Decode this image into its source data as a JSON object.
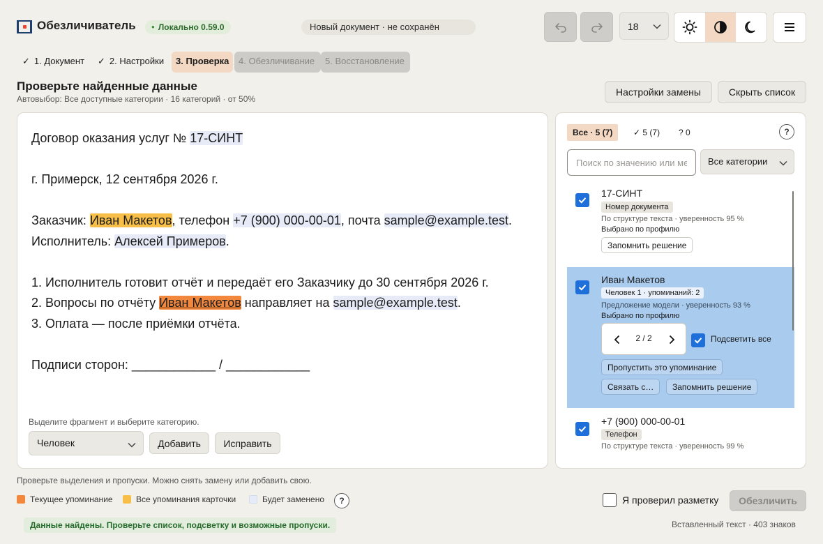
{
  "app": {
    "title": "Обезличиватель",
    "version_badge": "Локально 0.59.0",
    "document_name": "Новый документ · не сохранён",
    "font_size": "18",
    "accent_color": "#f3d8c3",
    "checkbox_color": "#1e6fd9"
  },
  "toolbar": {
    "undo_icon": "undo-icon",
    "redo_icon": "redo-icon",
    "themes": [
      "sun-icon",
      "contrast-icon",
      "moon-icon"
    ],
    "active_theme": "contrast-icon",
    "menu_icon": "hamburger-icon"
  },
  "steps": [
    {
      "label": "1. Документ",
      "state": "done"
    },
    {
      "label": "2. Настройки",
      "state": "done"
    },
    {
      "label": "3. Проверка",
      "state": "current"
    },
    {
      "label": "4. Обезличивание",
      "state": "locked"
    },
    {
      "label": "5. Восстановление",
      "state": "locked"
    }
  ],
  "page": {
    "title": "Проверьте найденные данные",
    "subtitle": "Автовыбор: Все доступные категории · 16 категорий · от 50%",
    "replace_settings_label": "Настройки замены",
    "hide_list_label": "Скрыть список"
  },
  "document": {
    "line1_prefix": "Договор оказания услуг № ",
    "line1_contract": "17-СИНТ",
    "line2": "г. Примерск, 12 сентября 2026 г.",
    "line3_prefix": "Заказчик: ",
    "line3_name": "Иван Макетов",
    "line3_mid": ", телефон ",
    "line3_phone": "+7 (900) 000-00-01",
    "line3_mid2": ", почта ",
    "line3_email": "sample@example.test",
    "line3_end": ".",
    "line4_prefix": "Исполнитель: ",
    "line4_name": "Алексей Примеров",
    "line4_end": ".",
    "line5": "1. Исполнитель готовит отчёт и передаёт его Заказчику до 30 сентября 2026 г.",
    "line6_prefix": "2. Вопросы по отчёту ",
    "line6_name": "Иван Макетов",
    "line6_mid": " направляет на ",
    "line6_email": "sample@example.test",
    "line6_end": ".",
    "line7": "3. Оплата — после приёмки отчёта.",
    "line8": "Подписи сторон: ____________ / ____________",
    "hint": "Выделите фрагмент и выберите категорию.",
    "category_value": "Человек",
    "add_label": "Добавить",
    "fix_label": "Исправить"
  },
  "list": {
    "filter_all": "Все · 5 (7)",
    "filter_confirmed": "5 (7)",
    "filter_unknown": "? 0",
    "help": "?",
    "search_placeholder": "Поиск по значению или мес",
    "category_filter": "Все категории",
    "items": [
      {
        "value": "17-СИНТ",
        "badge": "Номер документа",
        "confidence": "По структуре текста · уверенность 95 %",
        "profile": "Выбрано по профилю",
        "remember_label": "Запомнить решение",
        "checked": true
      },
      {
        "value": "Иван Макетов",
        "badge": "Человек 1 · упоминаний: 2",
        "confidence": "Предложение модели · уверенность 93 %",
        "profile": "Выбрано по профилю",
        "pager": "2 / 2",
        "highlight_all_label": "Подсветить все",
        "skip_label": "Пропустить это упоминание",
        "link_label": "Связать с…",
        "remember_label": "Запомнить решение",
        "checked": true,
        "selected": true
      },
      {
        "value": "+7 (900) 000-00-01",
        "badge": "Телефон",
        "confidence": "По структуре текста · уверенность 99 %",
        "checked": true
      }
    ]
  },
  "footer": {
    "hint": "Проверьте выделения и пропуски. Можно снять замену или добавить свою.",
    "legend_current": "Текущее упоминание",
    "legend_all": "Все упоминания карточки",
    "legend_replace": "Будет заменено",
    "legend_colors": {
      "current": "#f2883d",
      "all": "#f8bf48",
      "replace": "#e6ebf7"
    },
    "help": "?",
    "confirm_label": "Я проверил разметку",
    "anonymize_label": "Обезличить",
    "status": "Данные найдены. Проверьте список, подсветку и возможные пропуски.",
    "char_count": "Вставленный текст · 403 знаков"
  }
}
